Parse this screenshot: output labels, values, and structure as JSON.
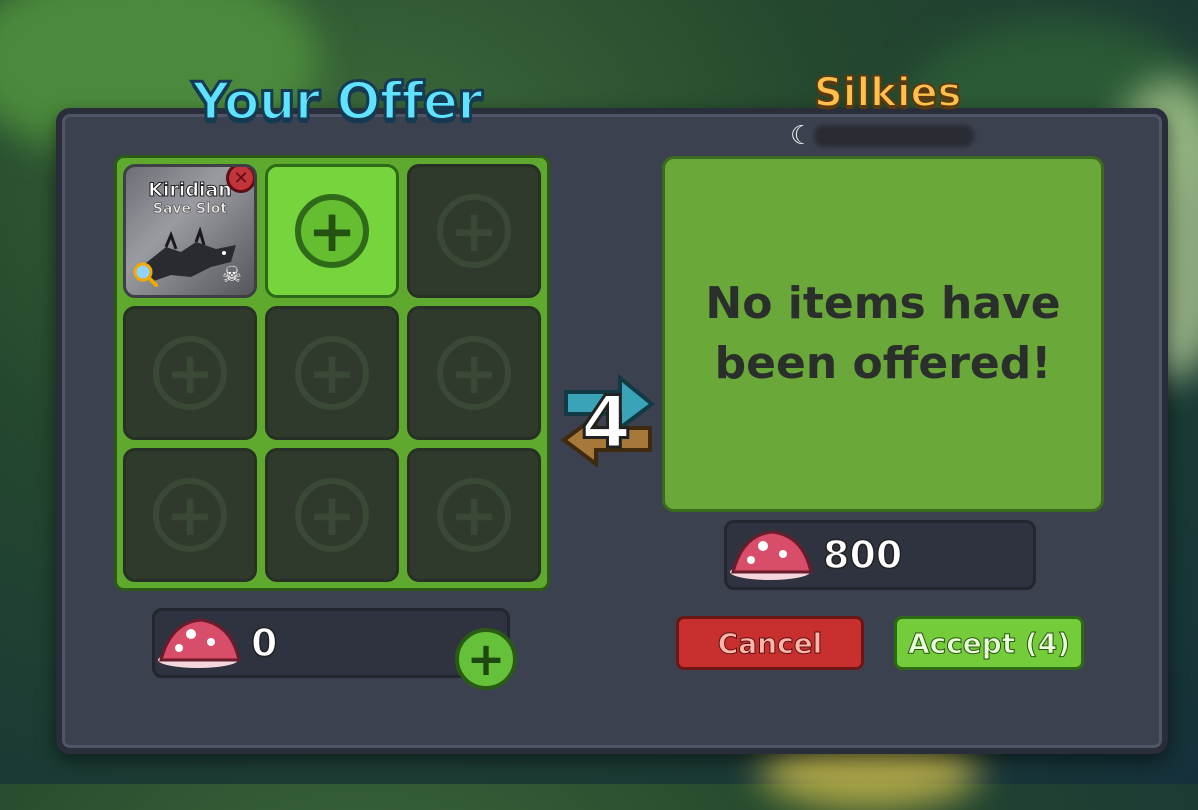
{
  "your_offer": {
    "title": "Your Offer",
    "slots": [
      {
        "type": "item",
        "name": "Kiridian",
        "subtitle": "Save Slot"
      },
      {
        "type": "add"
      },
      {
        "type": "empty"
      },
      {
        "type": "empty"
      },
      {
        "type": "empty"
      },
      {
        "type": "empty"
      },
      {
        "type": "empty"
      },
      {
        "type": "empty"
      },
      {
        "type": "empty"
      }
    ],
    "currency_value": "0"
  },
  "other_player": {
    "name": "Silkies",
    "empty_message_line1": "No items have",
    "empty_message_line2": "been offered!",
    "currency_value": "800"
  },
  "trade": {
    "countdown": "4"
  },
  "buttons": {
    "cancel_label": "Cancel",
    "accept_label": "Accept (4)"
  },
  "icons": {
    "currency": "mushroom-icon",
    "add": "plus-icon",
    "remove": "close-icon",
    "inspect": "magnifier-icon",
    "swap": "swap-arrows-icon"
  },
  "colors": {
    "title_your_offer": "#5fe3ff",
    "title_other": "#ffc04d",
    "cancel": "#c8302f",
    "accept": "#74cc3a",
    "grid_green": "#5faa2e"
  }
}
